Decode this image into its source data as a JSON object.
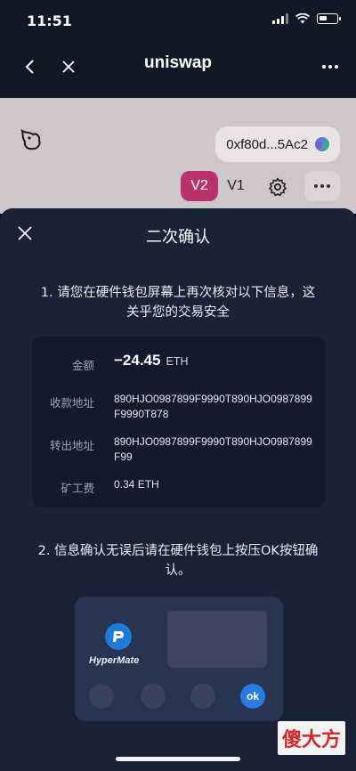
{
  "status_bar": {
    "time": "11:51"
  },
  "nav": {
    "title": "uniswap",
    "back_icon": "chevron-left-icon",
    "close_icon": "close-icon",
    "more_icon": "more-icon"
  },
  "web": {
    "wallet_address": "0xf80d...5Ac2",
    "version_active": "V2",
    "version_other": "V1"
  },
  "sheet": {
    "title": "二次确认",
    "step1": "1. 请您在硬件钱包屏幕上再次核对以下信息，这关乎您的交易安全",
    "rows": [
      {
        "label": "金额",
        "value": "−24.45",
        "unit": "ETH"
      },
      {
        "label": "收款地址",
        "value": "890HJO0987899F9990T890HJO0987899F9990T878"
      },
      {
        "label": "转出地址",
        "value": "890HJO0987899F9990T890HJO0987899F99"
      },
      {
        "label": "矿工费",
        "value": "0.34 ETH"
      }
    ],
    "step2": "2. 信息确认无误后请在硬件钱包上按压OK按钮确认。",
    "device": {
      "brand": "HyperMate",
      "ok_label": "ok"
    }
  },
  "watermark": "傻大方",
  "colors": {
    "accent_pink": "#b8336d",
    "ok_blue": "#2a7be0",
    "sheet_bg": "#1a2236"
  }
}
